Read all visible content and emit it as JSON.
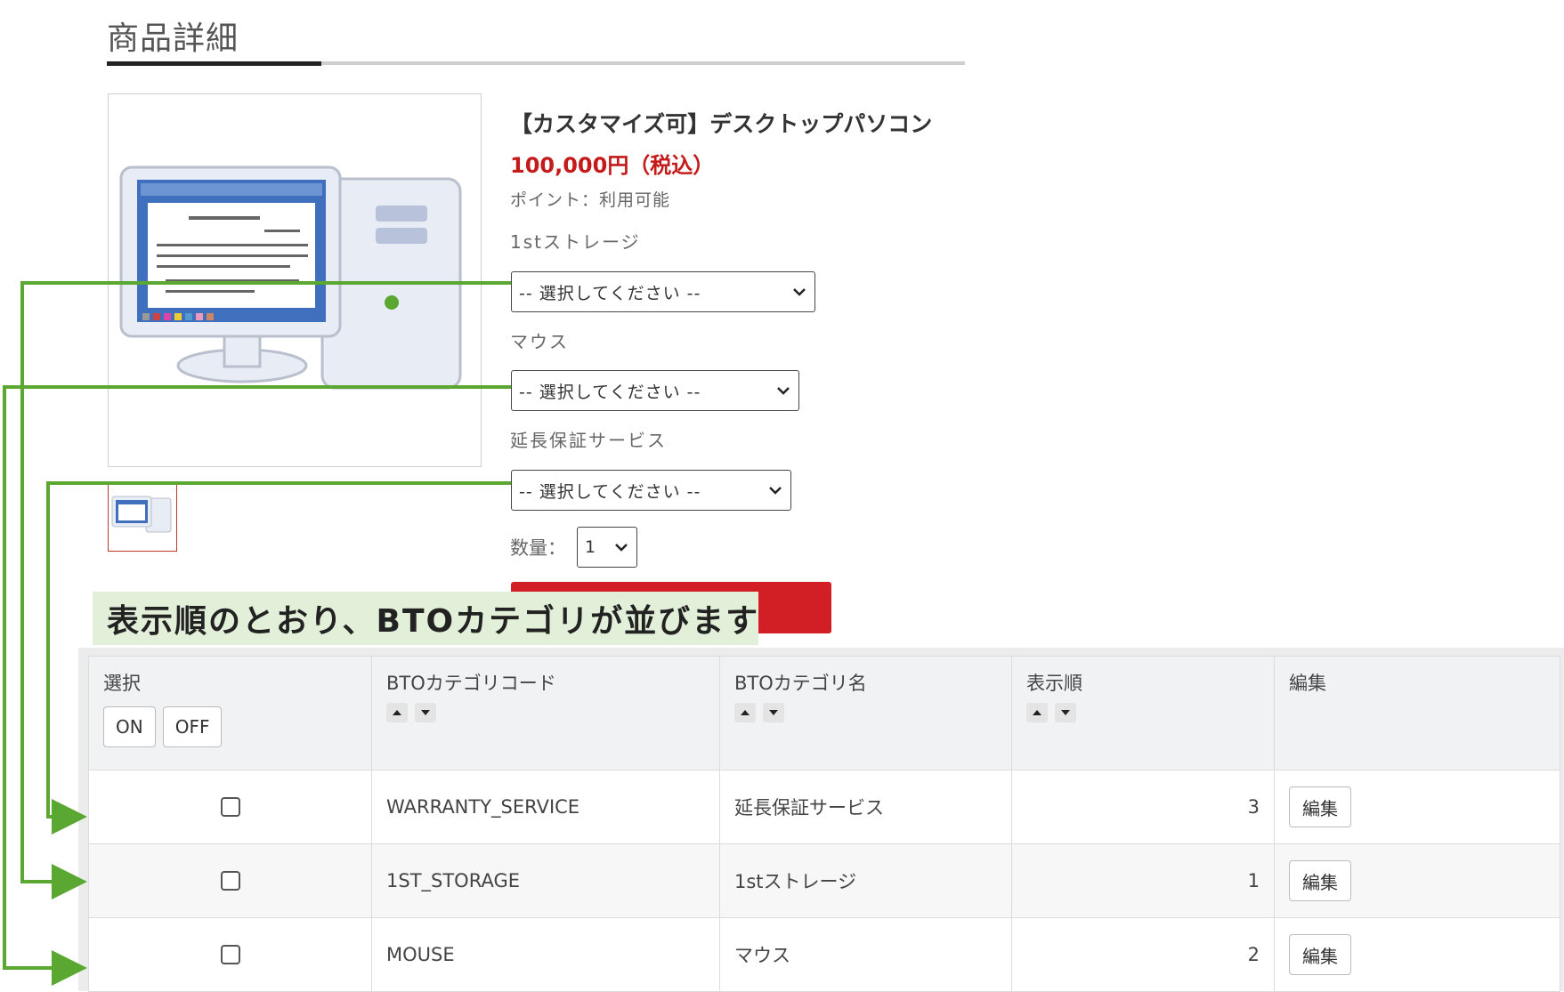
{
  "section": {
    "title": "商品詳細"
  },
  "product": {
    "name": "【カスタマイズ可】デスクトップパソコン",
    "price": "100,000円（税込）",
    "points": "ポイント：利用可能",
    "options": [
      {
        "label": "1stストレージ",
        "value": "-- 選択してください --"
      },
      {
        "label": "マウス",
        "value": "-- 選択してください --"
      },
      {
        "label": "延長保証サービス",
        "value": "-- 選択してください --"
      }
    ],
    "quantity": {
      "label": "数量：",
      "value": "1"
    }
  },
  "callout": "表示順のとおり、BTOカテゴリが並びます",
  "table": {
    "headers": {
      "select": "選択",
      "code": "BTOカテゴリコード",
      "name": "BTOカテゴリ名",
      "order": "表示順",
      "edit": "編集"
    },
    "on_label": "ON",
    "off_label": "OFF",
    "rows": [
      {
        "code": "WARRANTY_SERVICE",
        "name": "延長保証サービス",
        "order": "3",
        "edit": "編集"
      },
      {
        "code": "1ST_STORAGE",
        "name": "1stストレージ",
        "order": "1",
        "edit": "編集"
      },
      {
        "code": "MOUSE",
        "name": "マウス",
        "order": "2",
        "edit": "編集"
      }
    ]
  },
  "colors": {
    "accent_red": "#d21f26",
    "price_red": "#c41a1a",
    "arrow_green": "#5aa832",
    "callout_bg": "#e2efd9"
  }
}
